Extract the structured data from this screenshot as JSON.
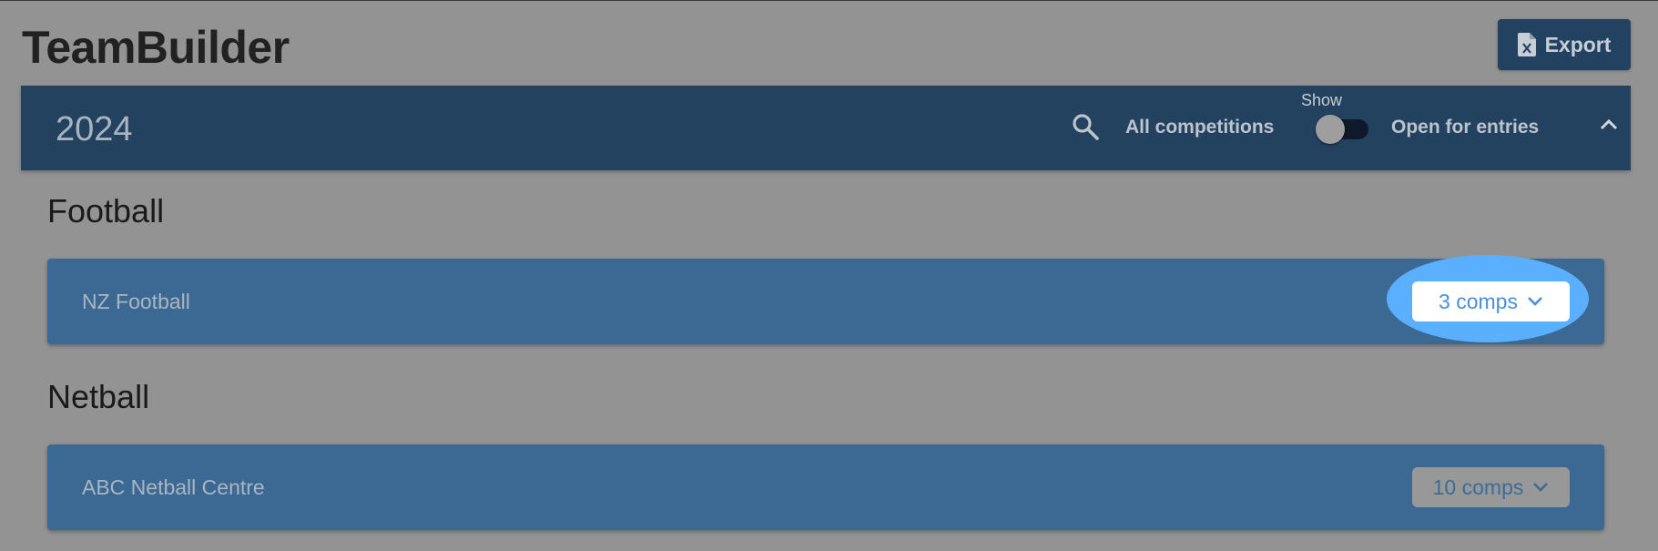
{
  "header": {
    "app_title": "TeamBuilder",
    "export_label": "Export"
  },
  "season_bar": {
    "year": "2024",
    "all_competitions_label": "All competitions",
    "toggle_label": "Show",
    "toggle_on": false,
    "open_for_entries_label": "Open for entries"
  },
  "sports": [
    {
      "name": "Football",
      "organisations": [
        {
          "name": "NZ Football",
          "comps_label": "3 comps",
          "highlighted": true
        }
      ]
    },
    {
      "name": "Netball",
      "organisations": [
        {
          "name": "ABC Netball Centre",
          "comps_label": "10 comps",
          "highlighted": false
        }
      ]
    }
  ],
  "colors": {
    "primary_dark": "#234260",
    "row_blue": "#3b6993",
    "highlight": "#5ab0ff",
    "overlay_gray": "#939393"
  }
}
